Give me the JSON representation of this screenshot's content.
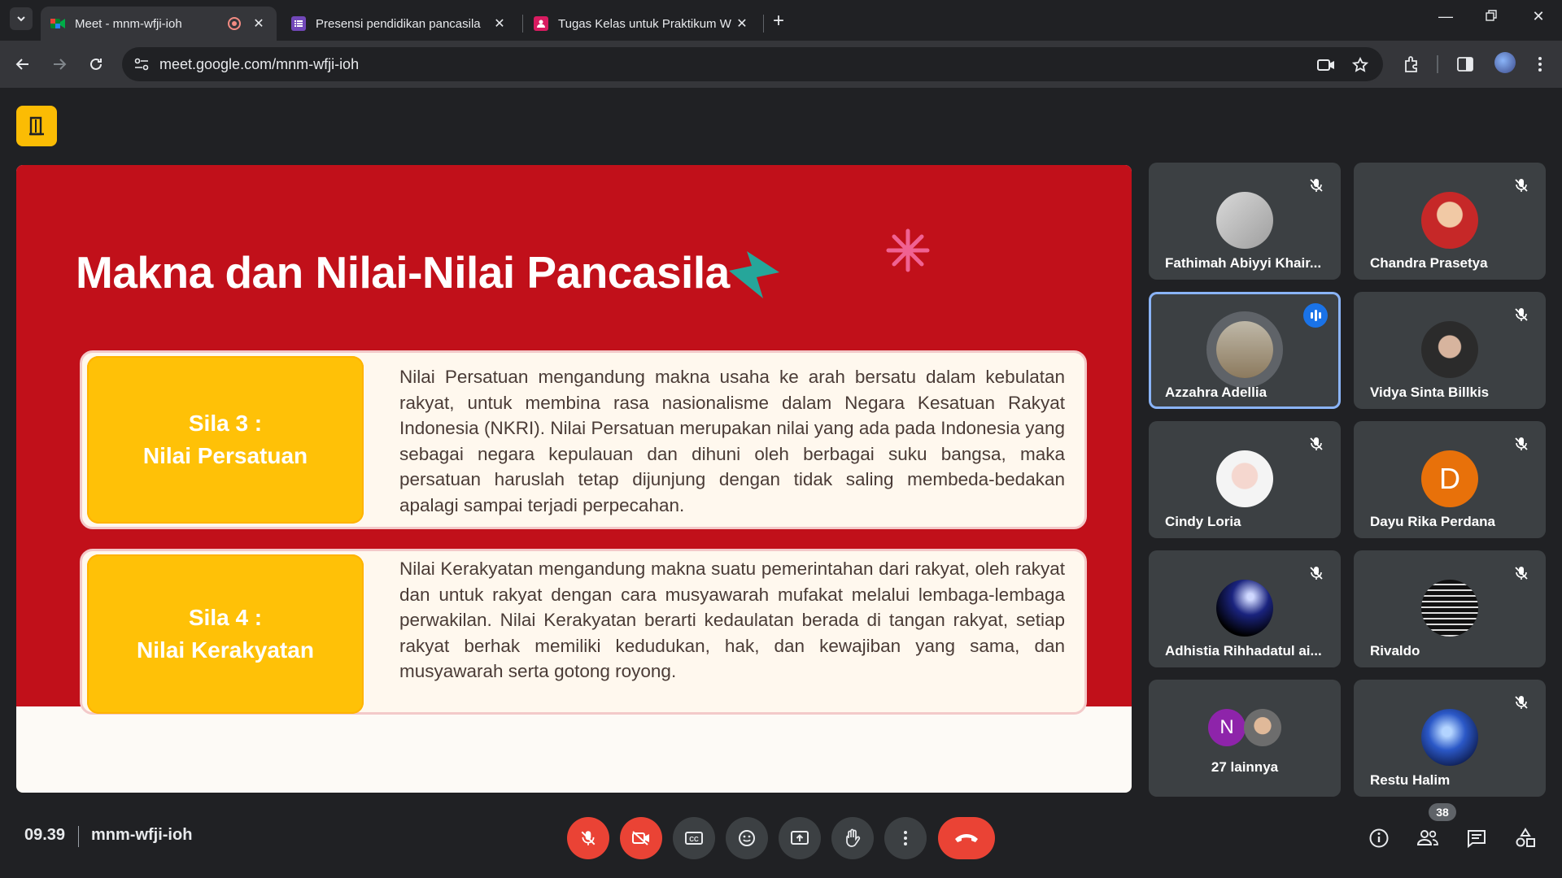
{
  "browser": {
    "tabs": [
      {
        "title": "Meet - mnm-wfji-ioh",
        "active": true,
        "recording": true
      },
      {
        "title": "Presensi pendidikan pancasila",
        "active": false
      },
      {
        "title": "Tugas Kelas untuk Praktikum W",
        "active": false
      }
    ],
    "url": "meet.google.com/mnm-wfji-ioh"
  },
  "slide": {
    "title": "Makna dan Nilai-Nilai Pancasila",
    "cards": [
      {
        "label_line1": "Sila 3 :",
        "label_line2": "Nilai Persatuan",
        "text": "Nilai Persatuan mengandung makna usaha ke arah bersatu dalam kebulatan rakyat, untuk membina rasa nasionalisme dalam Negara Kesatuan Rakyat Indonesia (NKRI). Nilai Persatuan merupakan nilai yang ada pada Indonesia yang sebagai negara kepulauan dan dihuni oleh berbagai suku bangsa, maka persatuan haruslah tetap dijunjung dengan tidak saling membeda-bedakan apalagi sampai terjadi perpecahan."
      },
      {
        "label_line1": "Sila 4 :",
        "label_line2": "Nilai Kerakyatan",
        "text": "Nilai Kerakyatan mengandung makna suatu pemerintahan dari rakyat, oleh rakyat dan untuk rakyat dengan cara musyawarah mufakat melalui lembaga-lembaga perwakilan. Nilai Kerakyatan berarti kedaulatan berada di tangan rakyat, setiap rakyat berhak memiliki kedudukan, hak, dan kewajiban yang sama, dan musyawarah serta gotong royong."
      }
    ]
  },
  "participants": [
    {
      "name": "Fathimah Abiyyi Khair...",
      "muted": true
    },
    {
      "name": "Chandra Prasetya",
      "muted": true
    },
    {
      "name": "Azzahra Adellia",
      "speaking": true
    },
    {
      "name": "Vidya Sinta Billkis",
      "muted": true
    },
    {
      "name": "Cindy Loria",
      "muted": true
    },
    {
      "name": "Dayu Rika Perdana",
      "muted": true,
      "initial": "D"
    },
    {
      "name": "Adhistia Rihhadatul ai...",
      "muted": true
    },
    {
      "name": "Rivaldo",
      "muted": true
    },
    {
      "name": "27 lainnya",
      "initial": "N"
    },
    {
      "name": "Restu Halim",
      "muted": true
    }
  ],
  "meeting": {
    "time": "09.39",
    "code": "mnm-wfji-ioh",
    "people_count": "38"
  },
  "colors": {
    "slide_red": "#c1101a",
    "label_yellow": "#ffc107",
    "end_call": "#ea4335",
    "speaking_blue": "#8ab4f8"
  }
}
